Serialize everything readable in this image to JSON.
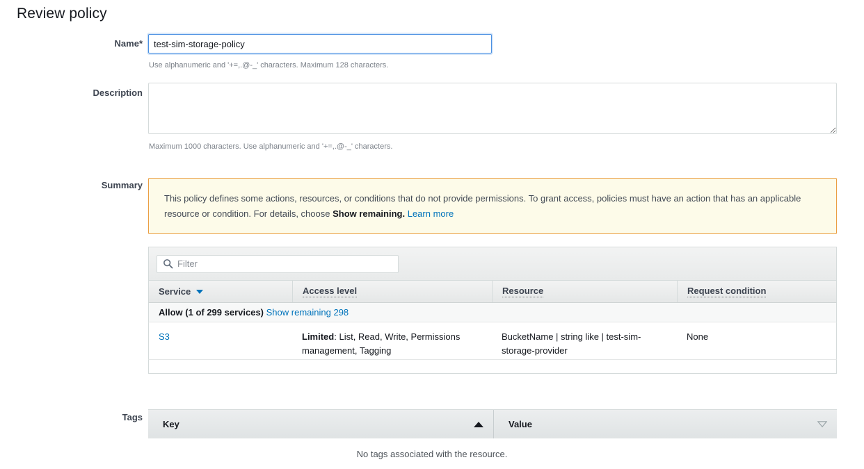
{
  "page": {
    "title": "Review policy"
  },
  "form": {
    "name": {
      "label": "Name*",
      "value": "test-sim-storage-policy",
      "placeholder": "",
      "hint": "Use alphanumeric and '+=,.@-_' characters. Maximum 128 characters."
    },
    "description": {
      "label": "Description",
      "value": "",
      "placeholder": "",
      "hint": "Maximum 1000 characters. Use alphanumeric and '+=,.@-_' characters."
    },
    "summary": {
      "label": "Summary"
    },
    "tags": {
      "label": "Tags"
    }
  },
  "alert": {
    "text_part1": "This policy defines some actions, resources, or conditions that do not provide permissions. To grant access, policies must have an action that has an applicable resource or condition. For details, choose ",
    "bold_text": "Show remaining.",
    "link_text": "Learn more",
    "border_color": "#eb9f43",
    "background_color": "#fdfbe9"
  },
  "summary_table": {
    "filter_placeholder": "Filter",
    "filter_value": "",
    "columns": [
      {
        "label": "Service",
        "sorted": true,
        "tooltip": false
      },
      {
        "label": "Access level",
        "sorted": false,
        "tooltip": true
      },
      {
        "label": "Resource",
        "sorted": false,
        "tooltip": true
      },
      {
        "label": "Request condition",
        "sorted": false,
        "tooltip": true
      }
    ],
    "group_row": {
      "label": "Allow (1 of 299 services)",
      "link": "Show remaining 298"
    },
    "rows": [
      {
        "service": "S3",
        "access_level_prefix": "Limited",
        "access_level": ": List, Read, Write, Permissions management, Tagging",
        "resource": "BucketName | string like | test-sim-storage-provider",
        "request_condition": "None"
      }
    ]
  },
  "tags_table": {
    "columns": [
      {
        "label": "Key",
        "sort": "asc"
      },
      {
        "label": "Value",
        "sort": "none"
      }
    ],
    "empty_message": "No tags associated with the resource."
  },
  "colors": {
    "link": "#0073bb",
    "focus_border": "#4a90e2",
    "warning_border": "#eb9f43",
    "warning_bg": "#fdfbe9"
  }
}
